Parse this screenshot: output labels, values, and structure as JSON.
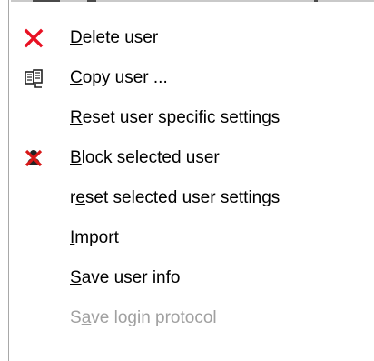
{
  "context_menu": {
    "items": [
      {
        "id": "delete-user",
        "pre": "",
        "accel": "D",
        "post": "elete user",
        "icon": "red-x-icon",
        "enabled": true
      },
      {
        "id": "copy-user",
        "pre": "",
        "accel": "C",
        "post": "opy user ...",
        "icon": "copy-user-icon",
        "enabled": true
      },
      {
        "id": "reset-user-specific-settings",
        "pre": "",
        "accel": "R",
        "post": "eset user specific settings",
        "icon": "",
        "enabled": true
      },
      {
        "id": "block-selected-user",
        "pre": "",
        "accel": "B",
        "post": "lock selected user",
        "icon": "block-user-icon",
        "enabled": true
      },
      {
        "id": "reset-selected-user-settings",
        "pre": "r",
        "accel": "e",
        "post": "set selected user settings",
        "icon": "",
        "enabled": true
      },
      {
        "id": "import",
        "pre": "",
        "accel": "I",
        "post": "mport",
        "icon": "",
        "enabled": true
      },
      {
        "id": "save-user-info",
        "pre": "",
        "accel": "S",
        "post": "ave user info",
        "icon": "",
        "enabled": true
      },
      {
        "id": "save-login-protocol",
        "pre": "S",
        "accel": "a",
        "post": "ve login protocol",
        "icon": "",
        "enabled": false
      }
    ]
  },
  "colors": {
    "delete_icon": "#e81123",
    "block_icon": "#d81818",
    "disabled_text": "#a0a0a0"
  }
}
